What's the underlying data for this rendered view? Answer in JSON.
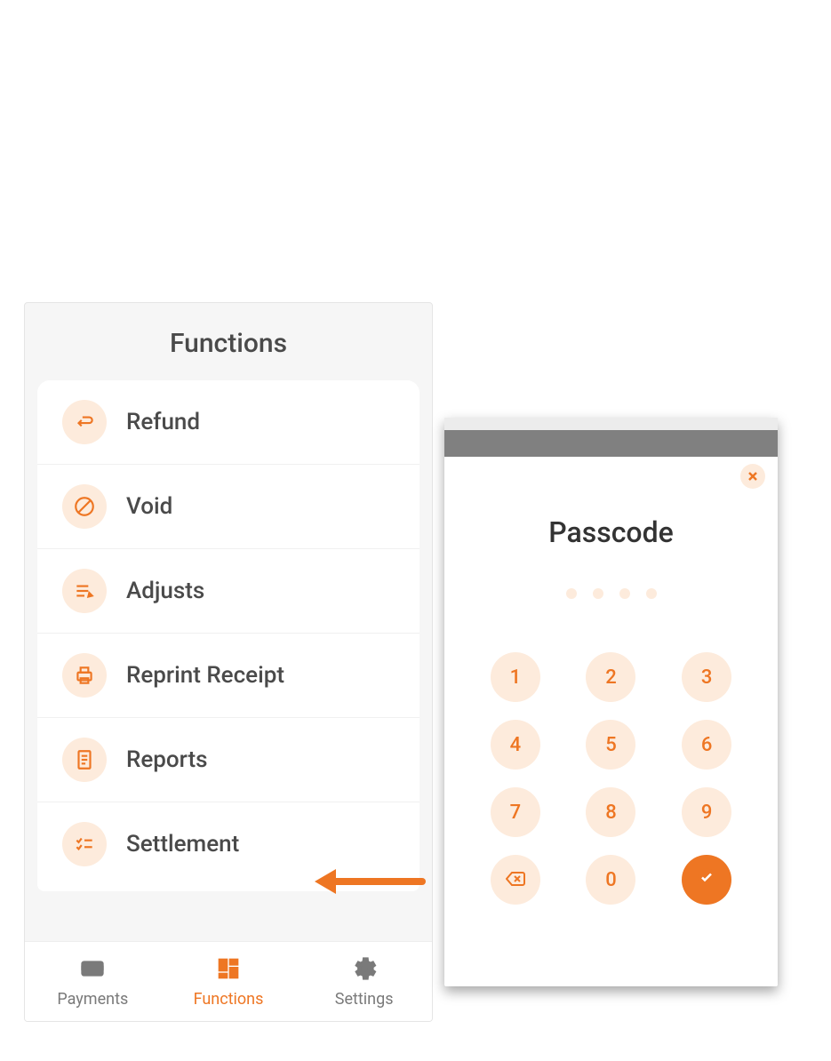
{
  "functionsScreen": {
    "title": "Functions",
    "items": [
      {
        "label": "Refund",
        "icon": "return-icon"
      },
      {
        "label": "Void",
        "icon": "prohibit-icon"
      },
      {
        "label": "Adjusts",
        "icon": "edit-lines-icon"
      },
      {
        "label": "Reprint Receipt",
        "icon": "printer-icon"
      },
      {
        "label": "Reports",
        "icon": "report-icon"
      },
      {
        "label": "Settlement",
        "icon": "checklist-icon"
      }
    ],
    "tabs": [
      {
        "label": "Payments",
        "icon": "card-icon",
        "active": false
      },
      {
        "label": "Functions",
        "icon": "grid-icon",
        "active": true
      },
      {
        "label": "Settings",
        "icon": "gear-icon",
        "active": false
      }
    ]
  },
  "passcodeScreen": {
    "title": "Passcode",
    "dots": 4,
    "keys": [
      "1",
      "2",
      "3",
      "4",
      "5",
      "6",
      "7",
      "8",
      "9"
    ],
    "backspaceKey": "backspace-icon",
    "zeroKey": "0",
    "confirmKey": "check-icon"
  },
  "arrow": {
    "color": "#ee7623"
  }
}
